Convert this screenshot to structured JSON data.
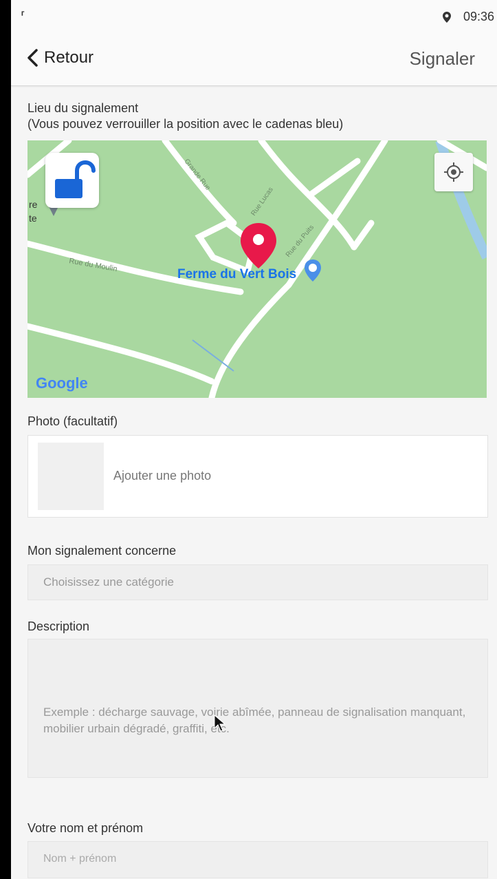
{
  "status_bar": {
    "left_icons": [
      "notification-icon",
      "notification-icon"
    ],
    "location_icon": "location-pin-icon",
    "time": "09:36"
  },
  "app_bar": {
    "back_label": "Retour",
    "action_label": "Signaler"
  },
  "location_section": {
    "label_line1": "Lieu du signalement",
    "label_line2": "(Vous pouvez verrouiller la position avec le cadenas bleu)",
    "map": {
      "poi_name": "Ferme du Vert Bois",
      "street_labels": [
        "Rue du Moulin",
        "Grande Rue",
        "Rue Lucas",
        "Rue du Puits"
      ],
      "attribution": "Google",
      "edge_text": "re\nte",
      "lock_color": "#1a66d6",
      "marker_color": "#e8194a"
    }
  },
  "photo_section": {
    "label": "Photo (facultatif)",
    "add_photo": "Ajouter une photo"
  },
  "category_section": {
    "label": "Mon signalement concerne",
    "placeholder": "Choisissez une catégorie"
  },
  "description_section": {
    "label": "Description",
    "placeholder": "Exemple : décharge sauvage, voirie abîmée, panneau de signalisation manquant, mobilier urbain dégradé, graffiti, etc."
  },
  "name_section": {
    "label": "Votre nom et prénom",
    "placeholder": "Nom + prénom"
  }
}
